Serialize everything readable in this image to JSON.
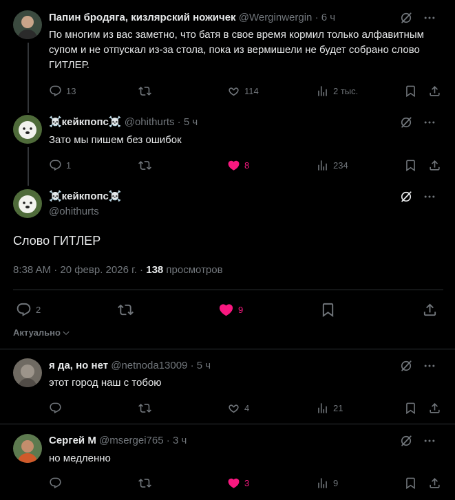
{
  "posts": [
    {
      "name": "Папин бродяга, кизлярский ножичек",
      "handle": "@Werginwergin",
      "time": "6 ч",
      "text": "По многим из вас заметно, что батя в свое время кормил только алфавитным супом и не отпускал из-за стола, пока из вермишели не будет собрано слово ГИТЛЕР.",
      "replies": "13",
      "reposts": "",
      "likes": "114",
      "views": "2 тыс.",
      "liked": false
    },
    {
      "name": "☠️кейкпопс☠️",
      "handle": "@ohithurts",
      "time": "5 ч",
      "text": "Зато мы пишем без ошибок",
      "replies": "1",
      "reposts": "",
      "likes": "8",
      "views": "234",
      "liked": true
    }
  ],
  "main": {
    "name": "☠️кейкпопс☠️",
    "handle": "@ohithurts",
    "text": "Слово ГИТЛЕР",
    "time": "8:38 AM · 20 февр. 2026 г. · ",
    "views_count": "138",
    "views_label": " просмотров",
    "replies": "2",
    "likes": "9",
    "sort_label": "Актуально"
  },
  "replies": [
    {
      "name": "я да, но нет",
      "handle": "@netnoda13009",
      "time": "5 ч",
      "text": "этот город наш с тобою",
      "replies": "",
      "likes": "4",
      "views": "21",
      "liked": false
    },
    {
      "name": "Сергей М",
      "handle": "@msergei765",
      "time": "3 ч",
      "text": "но медленно",
      "replies": "",
      "likes": "3",
      "views": "9",
      "liked": true
    }
  ],
  "colors": {
    "accent_like": "#f91880",
    "muted": "#71767b",
    "text": "#e7e9ea",
    "border": "#2f3336"
  },
  "icons": [
    "grok-icon",
    "more-icon",
    "reply-icon",
    "repost-icon",
    "like-icon",
    "views-icon",
    "bookmark-icon",
    "share-icon",
    "chevron-down-icon"
  ]
}
